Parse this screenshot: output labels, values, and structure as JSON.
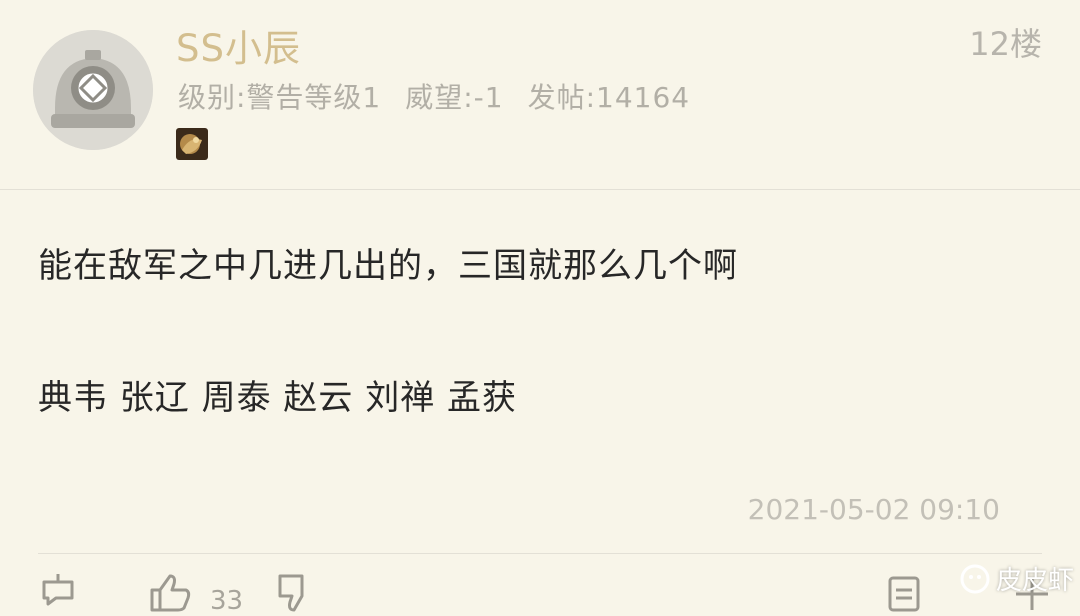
{
  "post": {
    "username": "SS小辰",
    "floor": "12楼",
    "level_label": "级别:警告等级1",
    "prestige_label": "威望:-1",
    "posts_label": "发帖:14164",
    "content_line1": "能在敌军之中几进几出的，三国就那么几个啊",
    "content_line2": "典韦 张辽 周泰 赵云 刘禅 孟获",
    "timestamp": "2021-05-02 09:10",
    "like_count": "33"
  },
  "icons": {
    "avatar": "diving-helmet-icon",
    "medal": "medal-badge-icon",
    "reply": "reply-icon",
    "like": "thumbs-up-icon",
    "dislike": "thumbs-down-icon",
    "quote": "document-icon",
    "more": "plus-icon"
  },
  "watermark": {
    "text": "皮皮虾"
  },
  "colors": {
    "background": "#f8f5e9",
    "username": "#d3be8e",
    "meta": "#b2afa6",
    "content": "#272727"
  }
}
